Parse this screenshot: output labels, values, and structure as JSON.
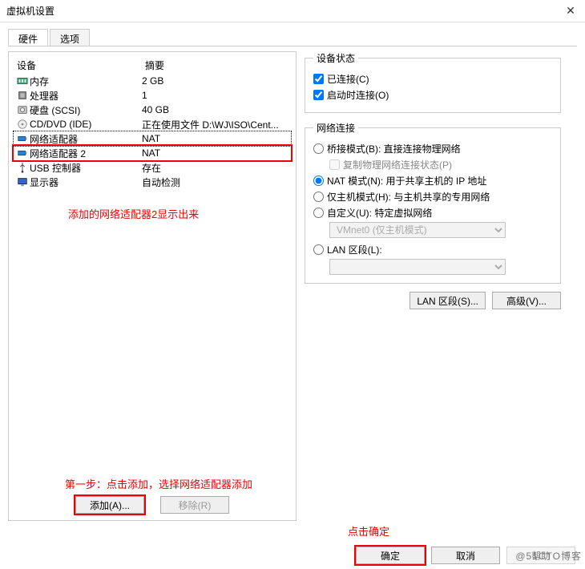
{
  "window": {
    "title": "虚拟机设置"
  },
  "tabs": {
    "hardware": "硬件",
    "options": "选项"
  },
  "left": {
    "col_device": "设备",
    "col_summary": "摘要",
    "devices": [
      {
        "icon": "memory-icon",
        "name": "内存",
        "summary": "2 GB"
      },
      {
        "icon": "cpu-icon",
        "name": "处理器",
        "summary": "1"
      },
      {
        "icon": "disk-icon",
        "name": "硬盘 (SCSI)",
        "summary": "40 GB"
      },
      {
        "icon": "cd-icon",
        "name": "CD/DVD (IDE)",
        "summary": "正在使用文件 D:\\WJ\\ISO\\Cent..."
      },
      {
        "icon": "nic-icon",
        "name": "网络适配器",
        "summary": "NAT"
      },
      {
        "icon": "nic-icon",
        "name": "网络适配器 2",
        "summary": "NAT"
      },
      {
        "icon": "usb-icon",
        "name": "USB 控制器",
        "summary": "存在"
      },
      {
        "icon": "display-icon",
        "name": "显示器",
        "summary": "自动检测"
      }
    ],
    "annotation1": "添加的网络适配器2显示出来",
    "annotation2": "第一步：点击添加，选择网络适配器添加",
    "add_btn": "添加(A)...",
    "remove_btn": "移除(R)"
  },
  "right": {
    "status_legend": "设备状态",
    "connected": "已连接(C)",
    "connect_at_power": "启动时连接(O)",
    "netconn_legend": "网络连接",
    "bridged": "桥接模式(B): 直接连接物理网络",
    "replicate": "复制物理网络连接状态(P)",
    "nat": "NAT 模式(N): 用于共享主机的 IP 地址",
    "hostonly": "仅主机模式(H): 与主机共享的专用网络",
    "custom": "自定义(U): 特定虚拟网络",
    "vmnet_sel": "VMnet0 (仅主机模式)",
    "lanseg": "LAN 区段(L):",
    "lanseg_btn": "LAN 区段(S)...",
    "adv_btn": "高级(V)..."
  },
  "footer": {
    "annotation": "点击确定",
    "ok": "确定",
    "cancel": "取消",
    "help": "帮助"
  },
  "watermark": "@51CTO博客"
}
